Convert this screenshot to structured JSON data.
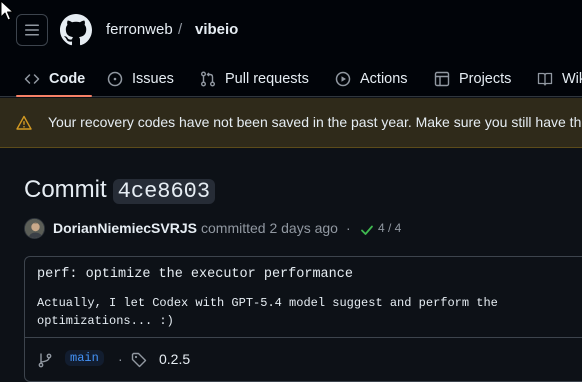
{
  "repo": {
    "owner": "ferronweb",
    "separator": "/",
    "name": "vibeio"
  },
  "tabs": [
    {
      "label": "Code",
      "icon": "code-icon",
      "active": true
    },
    {
      "label": "Issues",
      "icon": "issue-opened-icon"
    },
    {
      "label": "Pull requests",
      "icon": "git-pull-request-icon"
    },
    {
      "label": "Actions",
      "icon": "play-icon"
    },
    {
      "label": "Projects",
      "icon": "table-icon"
    },
    {
      "label": "Wiki",
      "icon": "book-icon"
    }
  ],
  "banner": {
    "icon": "alert-icon",
    "text": "Your recovery codes have not been saved in the past year. Make sure you still have them"
  },
  "commit": {
    "heading": "Commit",
    "sha": "4ce8603",
    "author": "DorianNiemiecSVRJS",
    "committed_text": "committed 2 days ago",
    "separator": "·",
    "checks": "4 / 4",
    "message_title": "perf: optimize the executor performance",
    "message_body": "Actually, I let Codex with GPT-5.4 model suggest and perform the optimizations... :)",
    "branch": "main",
    "tag": "0.2.5"
  },
  "colors": {
    "background": "#0d1117",
    "header": "#010409",
    "accent_underline": "#f78166",
    "warning_banner": "#2f2a1a",
    "warning_icon": "#d29922",
    "success": "#3fb950",
    "branch_link": "#4493f8"
  }
}
